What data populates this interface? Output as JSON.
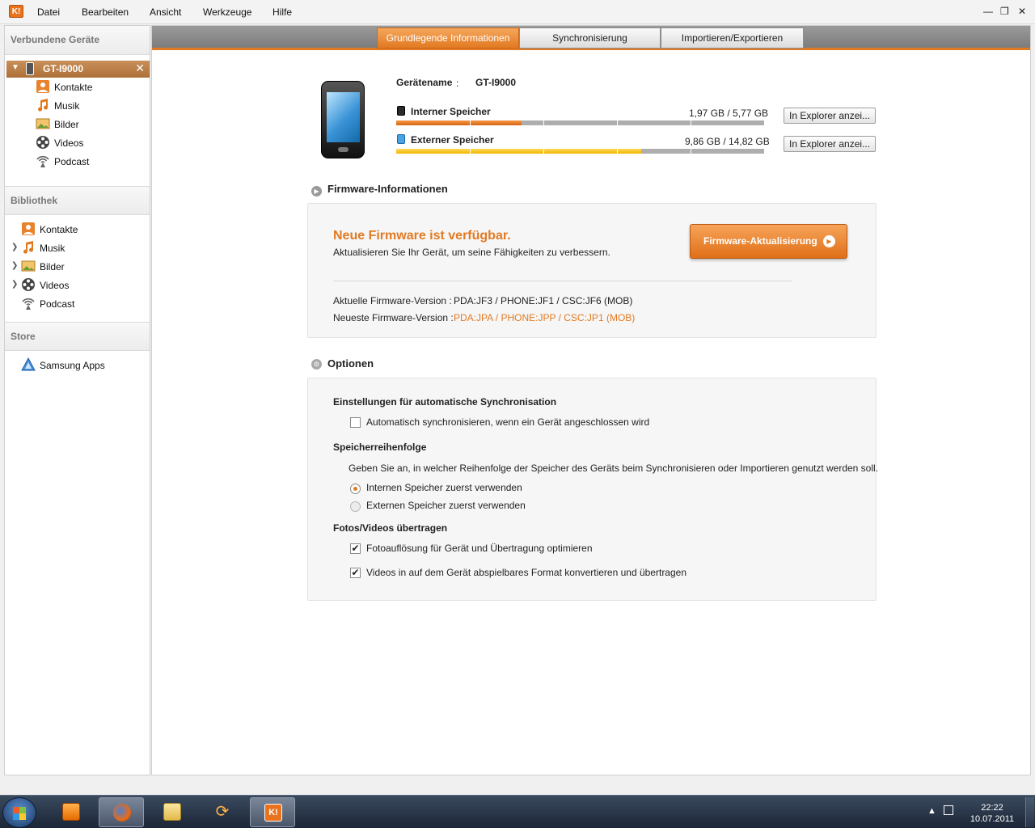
{
  "app": {
    "logo": "K!"
  },
  "menubar": {
    "items": [
      "Datei",
      "Bearbeiten",
      "Ansicht",
      "Werkzeuge",
      "Hilfe"
    ]
  },
  "sidebar": {
    "connected_header": "Verbundene Geräte",
    "device": {
      "name": "GT-I9000",
      "close": "✕"
    },
    "device_items": [
      "Kontakte",
      "Musik",
      "Bilder",
      "Videos",
      "Podcast"
    ],
    "library_header": "Bibliothek",
    "library_items": [
      "Kontakte",
      "Musik",
      "Bilder",
      "Videos",
      "Podcast"
    ],
    "store_header": "Store",
    "store_items": [
      "Samsung Apps"
    ]
  },
  "tabs": [
    "Grundlegende Informationen",
    "Synchronisierung",
    "Importieren/Exportieren"
  ],
  "active_tab": "Grundlegende Informationen",
  "device_info": {
    "name_label": "Gerätename",
    "colon": ":",
    "name_value": "GT-I9000",
    "internal": {
      "label": "Interner Speicher",
      "usage": "1,97 GB / 5,77 GB",
      "used_fraction": 0.34,
      "button": "In Explorer anzei..."
    },
    "external": {
      "label": "Externer Speicher",
      "usage": "9,86 GB / 14,82 GB",
      "used_fraction": 0.665,
      "button": "In Explorer anzei..."
    }
  },
  "firmware": {
    "section_title": "Firmware-Informationen",
    "headline": "Neue Firmware ist verfügbar.",
    "subtext": "Aktualisieren Sie Ihr Gerät, um seine Fähigkeiten zu verbessern.",
    "button": "Firmware-Aktualisierung",
    "current_label": "Aktuelle Firmware-Version :",
    "current_value": "PDA:JF3 / PHONE:JF1 / CSC:JF6 (MOB)",
    "latest_label": "Neueste Firmware-Version :",
    "latest_value": "PDA:JPA / PHONE:JPP / CSC:JP1 (MOB)"
  },
  "options": {
    "section_title": "Optionen",
    "auto_sync_header": "Einstellungen für automatische Synchronisation",
    "auto_sync_label": "Automatisch synchronisieren, wenn ein Gerät angeschlossen wird",
    "auto_sync_checked": false,
    "storage_order_header": "Speicherreihenfolge",
    "storage_order_desc": "Geben Sie an, in welcher Reihenfolge der Speicher des Geräts beim Synchronisieren oder Importieren genutzt werden soll.",
    "radio_internal": "Internen Speicher zuerst verwenden",
    "radio_external": "Externen Speicher zuerst verwenden",
    "selected": "internal",
    "media_header": "Fotos/Videos übertragen",
    "photo_opt": "Fotoauflösung für Gerät und Übertragung optimieren",
    "photo_checked": true,
    "video_opt": "Videos in auf dem Gerät abspielbares Format konvertieren und übertragen",
    "video_checked": true
  },
  "taskbar": {
    "time": "22:22",
    "date": "10.07.2011"
  },
  "colors": {
    "accent": "#e27a22",
    "tabbar": "#8a8a8a",
    "sidebar_selected": "#b97a44"
  }
}
